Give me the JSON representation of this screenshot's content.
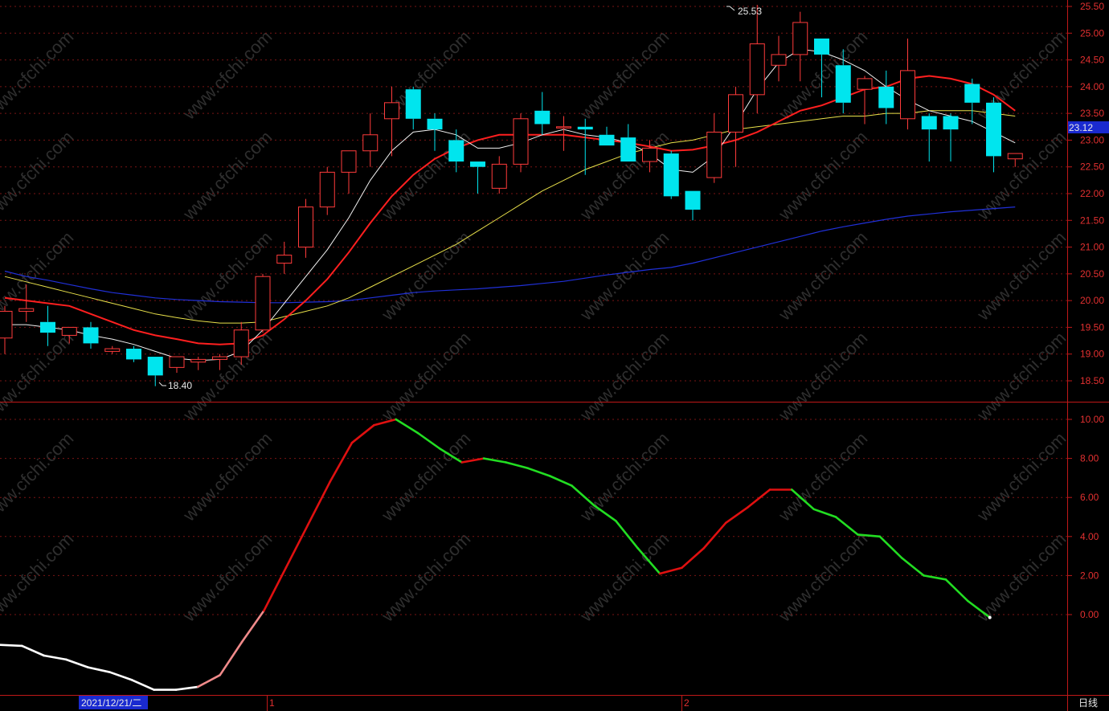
{
  "chart_data": [
    {
      "type": "candlestick",
      "title": "",
      "ylim": [
        18.0,
        25.6
      ],
      "yticks": [
        "25.50",
        "25.00",
        "24.50",
        "24.00",
        "23.50",
        "23.00",
        "22.50",
        "22.00",
        "21.50",
        "21.00",
        "20.50",
        "20.00",
        "19.50",
        "19.00",
        "18.50"
      ],
      "current_price": "23.12",
      "annotations": {
        "high": "25.53",
        "low": "18.40"
      },
      "colors": {
        "up": "#ff3b3b",
        "down": "#00e5ee",
        "ma_white": "#f0f0f0",
        "ma_red": "#ff1f1f",
        "ma_yellow": "#e8e04a",
        "ma_blue": "#2030d8"
      },
      "candles": [
        {
          "o": 19.3,
          "h": 19.9,
          "l": 19.0,
          "c": 19.8
        },
        {
          "o": 19.8,
          "h": 20.3,
          "l": 19.6,
          "c": 19.85
        },
        {
          "o": 19.6,
          "h": 19.9,
          "l": 19.15,
          "c": 19.4
        },
        {
          "o": 19.35,
          "h": 19.5,
          "l": 19.2,
          "c": 19.5
        },
        {
          "o": 19.5,
          "h": 19.6,
          "l": 19.1,
          "c": 19.2
        },
        {
          "o": 19.05,
          "h": 19.15,
          "l": 19.0,
          "c": 19.1
        },
        {
          "o": 19.1,
          "h": 19.15,
          "l": 18.85,
          "c": 18.9
        },
        {
          "o": 18.95,
          "h": 18.95,
          "l": 18.4,
          "c": 18.6
        },
        {
          "o": 18.75,
          "h": 18.95,
          "l": 18.65,
          "c": 18.95
        },
        {
          "o": 18.85,
          "h": 18.95,
          "l": 18.7,
          "c": 18.9
        },
        {
          "o": 18.9,
          "h": 19.0,
          "l": 18.7,
          "c": 18.95
        },
        {
          "o": 18.95,
          "h": 19.6,
          "l": 18.8,
          "c": 19.45
        },
        {
          "o": 19.45,
          "h": 20.5,
          "l": 19.4,
          "c": 20.45
        },
        {
          "o": 20.7,
          "h": 21.1,
          "l": 20.5,
          "c": 20.85
        },
        {
          "o": 21.0,
          "h": 21.9,
          "l": 20.8,
          "c": 21.75
        },
        {
          "o": 21.75,
          "h": 22.5,
          "l": 21.6,
          "c": 22.4
        },
        {
          "o": 22.4,
          "h": 22.8,
          "l": 22.0,
          "c": 22.8
        },
        {
          "o": 22.8,
          "h": 23.5,
          "l": 22.5,
          "c": 23.1
        },
        {
          "o": 23.4,
          "h": 24.0,
          "l": 22.7,
          "c": 23.7
        },
        {
          "o": 23.95,
          "h": 24.0,
          "l": 23.2,
          "c": 23.4
        },
        {
          "o": 23.4,
          "h": 23.5,
          "l": 22.8,
          "c": 23.2
        },
        {
          "o": 23.0,
          "h": 23.2,
          "l": 22.4,
          "c": 22.6
        },
        {
          "o": 22.6,
          "h": 22.6,
          "l": 22.0,
          "c": 22.5
        },
        {
          "o": 22.1,
          "h": 22.7,
          "l": 22.0,
          "c": 22.55
        },
        {
          "o": 22.55,
          "h": 23.5,
          "l": 22.4,
          "c": 23.4
        },
        {
          "o": 23.55,
          "h": 23.9,
          "l": 23.1,
          "c": 23.3
        },
        {
          "o": 23.25,
          "h": 23.45,
          "l": 22.8,
          "c": 23.25
        },
        {
          "o": 23.25,
          "h": 23.4,
          "l": 22.35,
          "c": 23.2
        },
        {
          "o": 23.1,
          "h": 23.25,
          "l": 22.9,
          "c": 22.9
        },
        {
          "o": 23.05,
          "h": 23.3,
          "l": 22.6,
          "c": 22.6
        },
        {
          "o": 22.6,
          "h": 23.0,
          "l": 22.4,
          "c": 22.85
        },
        {
          "o": 22.75,
          "h": 22.8,
          "l": 21.9,
          "c": 21.95
        },
        {
          "o": 22.05,
          "h": 22.05,
          "l": 21.5,
          "c": 21.7
        },
        {
          "o": 22.3,
          "h": 23.5,
          "l": 22.2,
          "c": 23.15
        },
        {
          "o": 23.15,
          "h": 24.0,
          "l": 22.5,
          "c": 23.85
        },
        {
          "o": 23.85,
          "h": 25.53,
          "l": 23.5,
          "c": 24.8
        },
        {
          "o": 24.4,
          "h": 24.95,
          "l": 24.1,
          "c": 24.6
        },
        {
          "o": 24.6,
          "h": 25.4,
          "l": 24.1,
          "c": 25.2
        },
        {
          "o": 24.9,
          "h": 24.9,
          "l": 23.8,
          "c": 24.6
        },
        {
          "o": 24.4,
          "h": 24.7,
          "l": 23.5,
          "c": 23.7
        },
        {
          "o": 23.95,
          "h": 24.2,
          "l": 23.3,
          "c": 24.15
        },
        {
          "o": 24.0,
          "h": 24.3,
          "l": 23.3,
          "c": 23.6
        },
        {
          "o": 23.4,
          "h": 24.9,
          "l": 23.2,
          "c": 24.3
        },
        {
          "o": 23.45,
          "h": 23.5,
          "l": 22.6,
          "c": 23.2
        },
        {
          "o": 23.45,
          "h": 23.5,
          "l": 22.6,
          "c": 23.2
        },
        {
          "o": 24.05,
          "h": 24.15,
          "l": 23.3,
          "c": 23.7
        },
        {
          "o": 23.7,
          "h": 23.8,
          "l": 22.4,
          "c": 22.7
        },
        {
          "o": 22.65,
          "h": 22.75,
          "l": 22.5,
          "c": 22.75
        }
      ],
      "ma_white": [
        19.55,
        19.55,
        19.5,
        19.45,
        19.35,
        19.28,
        19.18,
        19.05,
        18.92,
        18.88,
        18.9,
        19.05,
        19.45,
        19.95,
        20.45,
        20.95,
        21.55,
        22.25,
        22.8,
        23.15,
        23.2,
        23.1,
        22.85,
        22.85,
        22.95,
        23.1,
        23.2,
        23.1,
        23.05,
        22.95,
        22.75,
        22.45,
        22.4,
        22.7,
        23.3,
        23.95,
        24.45,
        24.7,
        24.65,
        24.5,
        24.3,
        24.0,
        23.75,
        23.55,
        23.45,
        23.35,
        23.15,
        22.95
      ],
      "ma_red": [
        20.05,
        20.0,
        19.95,
        19.9,
        19.75,
        19.6,
        19.45,
        19.35,
        19.28,
        19.2,
        19.18,
        19.2,
        19.35,
        19.65,
        20.0,
        20.4,
        20.9,
        21.45,
        21.95,
        22.35,
        22.65,
        22.85,
        23.0,
        23.1,
        23.1,
        23.1,
        23.1,
        23.05,
        23.0,
        22.95,
        22.88,
        22.8,
        22.82,
        22.9,
        23.0,
        23.15,
        23.35,
        23.55,
        23.65,
        23.8,
        23.95,
        24.0,
        24.15,
        24.2,
        24.15,
        24.05,
        23.85,
        23.55
      ],
      "ma_yellow": [
        20.45,
        20.35,
        20.25,
        20.15,
        20.05,
        19.95,
        19.85,
        19.75,
        19.68,
        19.62,
        19.58,
        19.58,
        19.6,
        19.7,
        19.8,
        19.9,
        20.05,
        20.25,
        20.45,
        20.65,
        20.85,
        21.05,
        21.3,
        21.55,
        21.8,
        22.05,
        22.25,
        22.45,
        22.6,
        22.75,
        22.85,
        22.95,
        23.0,
        23.1,
        23.2,
        23.25,
        23.3,
        23.35,
        23.4,
        23.45,
        23.45,
        23.5,
        23.5,
        23.55,
        23.55,
        23.55,
        23.5,
        23.45
      ],
      "ma_blue": [
        20.55,
        20.45,
        20.38,
        20.3,
        20.22,
        20.15,
        20.1,
        20.05,
        20.02,
        20.0,
        19.98,
        19.97,
        19.96,
        19.96,
        19.97,
        19.98,
        20.0,
        20.05,
        20.1,
        20.15,
        20.18,
        20.2,
        20.22,
        20.25,
        20.28,
        20.32,
        20.36,
        20.42,
        20.48,
        20.53,
        20.58,
        20.62,
        20.7,
        20.8,
        20.9,
        21.0,
        21.1,
        21.2,
        21.3,
        21.38,
        21.45,
        21.52,
        21.58,
        21.62,
        21.66,
        21.69,
        21.72,
        21.75
      ]
    },
    {
      "type": "line",
      "title": "",
      "ylim": [
        -0.4,
        10.4
      ],
      "yticks": [
        "10.00",
        "8.00",
        "6.00",
        "4.00",
        "2.00",
        "0.00"
      ],
      "colors": {
        "falling_early": "#ffffff",
        "rising_early": "#f08a8a",
        "rising": "#e01010",
        "falling": "#22dd22"
      },
      "values": [
        -1.55,
        -1.6,
        -2.1,
        -2.3,
        -2.7,
        -2.95,
        -3.35,
        -3.85,
        -3.85,
        -3.7,
        -3.1,
        -1.4,
        0.2,
        2.4,
        4.6,
        6.8,
        8.8,
        9.7,
        10.0,
        9.3,
        8.5,
        7.8,
        8.0,
        7.8,
        7.5,
        7.1,
        6.6,
        5.6,
        4.8,
        3.4,
        2.1,
        2.4,
        3.4,
        4.7,
        5.5,
        6.4,
        6.4,
        5.4,
        5.0,
        4.1,
        4.0,
        2.9,
        2.0,
        1.8,
        0.7,
        -0.15
      ]
    }
  ],
  "footer": {
    "date_label": "2021/12/21/二",
    "markers": [
      "1",
      "2"
    ],
    "period_label": "日线"
  },
  "watermark": "www.cfchi.com"
}
